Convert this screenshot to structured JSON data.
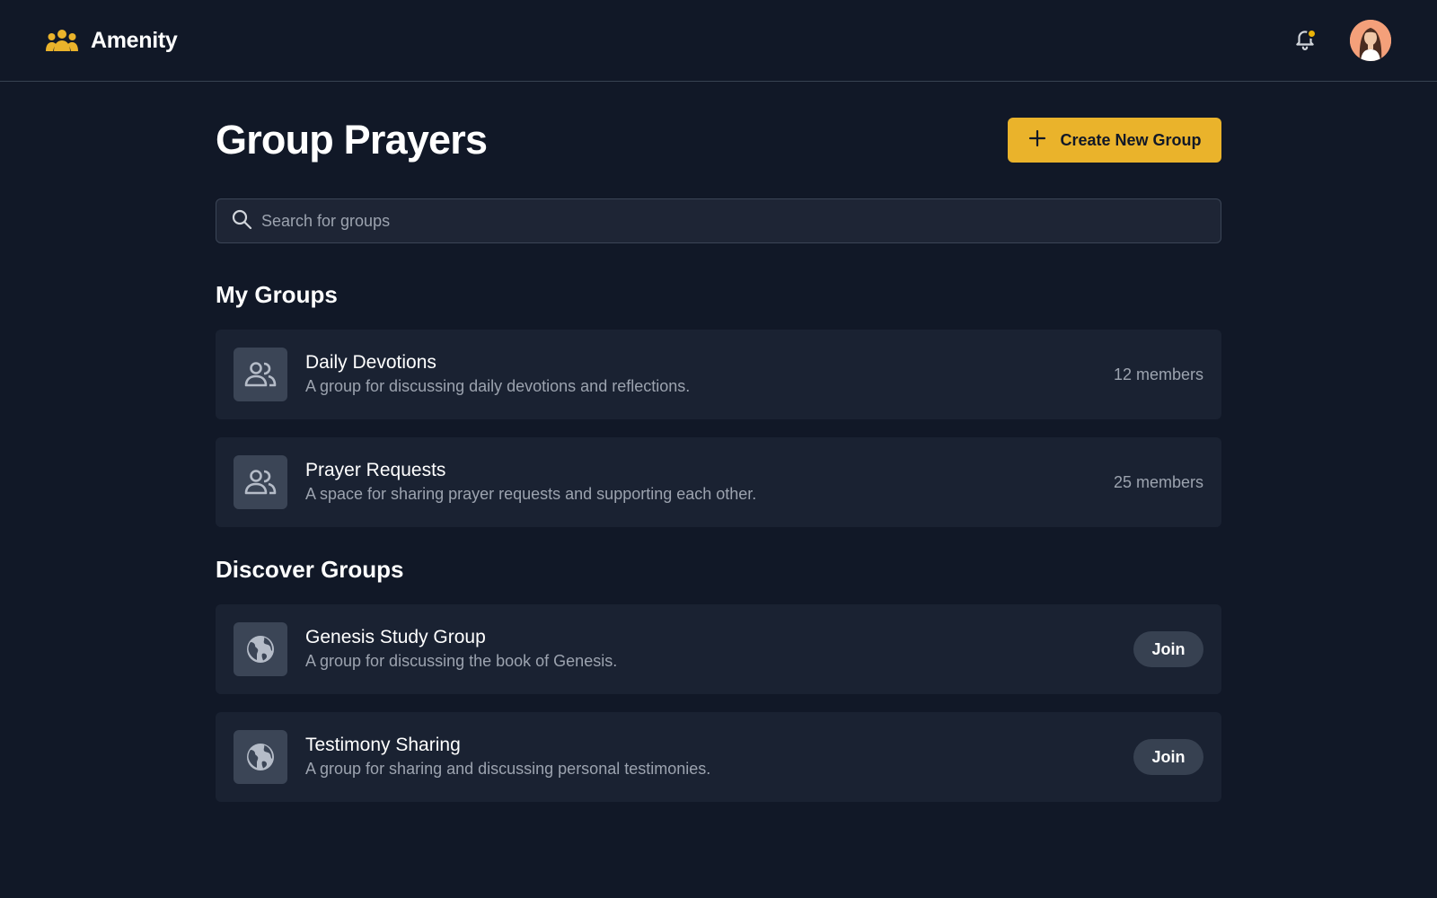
{
  "header": {
    "app_name": "Amenity",
    "logo_icon": "people-group-icon",
    "notification_icon": "bell-icon",
    "notification_badge_color": "#eab308",
    "avatar": "user-avatar"
  },
  "page": {
    "title": "Group Prayers",
    "create_button_label": "Create New Group",
    "create_button_icon": "plus-icon"
  },
  "search": {
    "placeholder": "Search for groups",
    "value": ""
  },
  "my_groups": {
    "title": "My Groups",
    "items": [
      {
        "name": "Daily Devotions",
        "description": "A group for discussing daily devotions and reflections.",
        "members": "12 members",
        "icon": "people-icon"
      },
      {
        "name": "Prayer Requests",
        "description": "A space for sharing prayer requests and supporting each other.",
        "members": "25 members",
        "icon": "people-icon"
      }
    ]
  },
  "discover_groups": {
    "title": "Discover Groups",
    "items": [
      {
        "name": "Genesis Study Group",
        "description": "A group for discussing the book of Genesis.",
        "action": "Join",
        "icon": "globe-icon"
      },
      {
        "name": "Testimony Sharing",
        "description": "A group for sharing and discussing personal testimonies.",
        "action": "Join",
        "icon": "globe-icon"
      }
    ]
  },
  "colors": {
    "background": "#111827",
    "card": "#1a2232",
    "accent": "#eab32b",
    "muted_text": "#9ca3af"
  }
}
